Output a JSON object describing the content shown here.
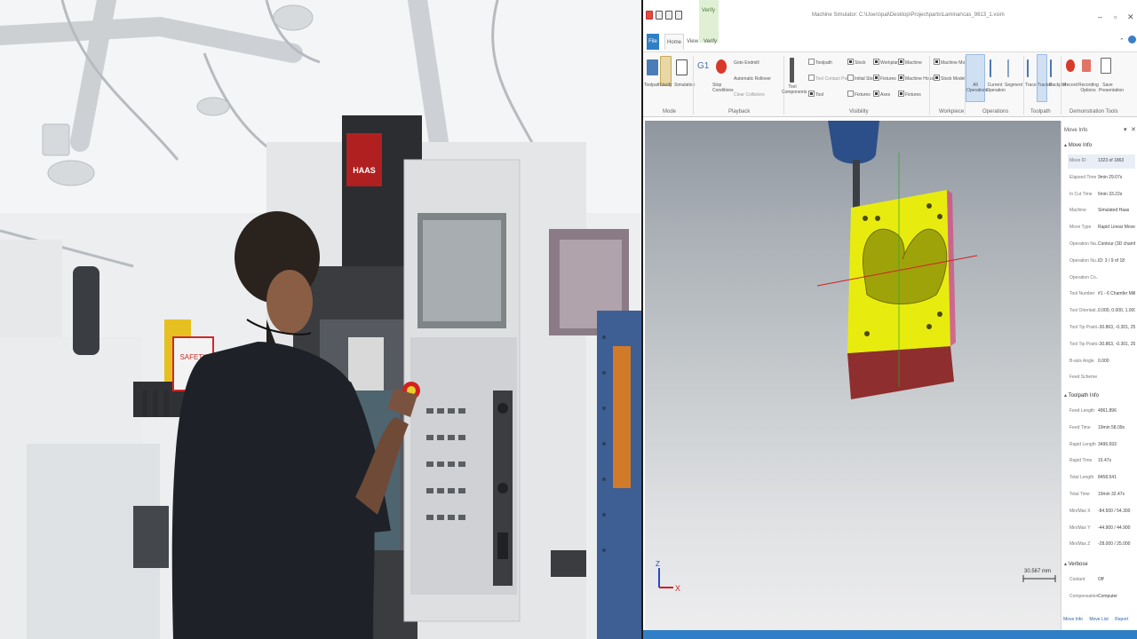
{
  "app": {
    "title": "Machine Simulator: C:\\Users\\pal\\Desktop\\Project\\parts\\Laminar\\cas_9813_1.vsim",
    "context_tab": "Verify",
    "tabs": [
      "File",
      "Home",
      "View",
      "Verify"
    ],
    "active_tab": "Home"
  },
  "ribbon": {
    "mode_buttons": [
      "Toolpath",
      "Verify",
      "Simulation"
    ],
    "playback_buttons": [
      "G1",
      "Stop Conditions"
    ],
    "playback_options": [
      "Goto Endmill",
      "Automatic Rollover",
      "Clear Collisions"
    ],
    "tool_component": "Tool Components",
    "visibility_col1": [
      "Toolpath",
      "Tool Contact Point",
      "Tool"
    ],
    "visibility_col2": [
      "Stock",
      "Initial Stock",
      "Fixtures"
    ],
    "visibility_col3": [
      "Workplane",
      "Fixtures",
      "Axes"
    ],
    "visibility_col4": [
      "Machine",
      "Machine Housing",
      "Fixtures"
    ],
    "workpiece_options": [
      "Machine Model",
      "Stock Model"
    ],
    "operation_buttons": [
      "All Operations",
      "Current Operation",
      "Segment"
    ],
    "toolpath_buttons": [
      "Trace",
      "Tracker",
      "Backplot"
    ],
    "demo_buttons": [
      "Record",
      "Recording Options",
      "Save Presentation"
    ],
    "groups": [
      "Mode",
      "Playback",
      "Visibility",
      "Workpiece",
      "Operations",
      "Toolpath",
      "Demonstration Tools"
    ]
  },
  "viewport": {
    "scale_label": "30.567 mm",
    "triad": {
      "z": "Z",
      "x": "X"
    },
    "colors": {
      "stock": "#e8ec0e",
      "base": "#8f2e2e",
      "tool": "#3a3f44",
      "spindle": "#2c4f8a"
    }
  },
  "panel": {
    "title": "Move Info",
    "sections": [
      {
        "name": "Move Info",
        "rows": [
          {
            "k": "Move ID",
            "v": "1323 of 1863"
          },
          {
            "k": "Elapsed Time",
            "v": "9min 29.07s"
          },
          {
            "k": "In Cut Time",
            "v": "6min 33.22s"
          },
          {
            "k": "Machine",
            "v": "Simulated Haas"
          },
          {
            "k": "Move Type",
            "v": "Rapid Linear Move"
          },
          {
            "k": "Operation Na...",
            "v": "Contour (3D chamf)"
          },
          {
            "k": "Operation Nu...",
            "v": "ID: 3 / 9 of 18"
          },
          {
            "k": "Operation Co...",
            "v": ""
          },
          {
            "k": "Tool Number",
            "v": "#1 - 6 Chamfer Mill"
          },
          {
            "k": "Tool Orientati...",
            "v": "0.000, 0.000, 1.000"
          },
          {
            "k": "Tool Tip Positi...",
            "v": "-30.863, -0.301, 25"
          },
          {
            "k": "Tool Tip Positi...",
            "v": "-30.863, -0.301, 25"
          },
          {
            "k": "B-axis Angle",
            "v": "0.000"
          },
          {
            "k": "Feed Scheme",
            "v": ""
          }
        ]
      },
      {
        "name": "Toolpath Info",
        "rows": [
          {
            "k": "Feed Length",
            "v": "4961.896"
          },
          {
            "k": "Feed Time",
            "v": "19min 58.09s"
          },
          {
            "k": "Rapid Length",
            "v": "3496.693"
          },
          {
            "k": "Rapid Time",
            "v": "15.47s"
          },
          {
            "k": "Total Length",
            "v": "8458.541"
          },
          {
            "k": "Total Time",
            "v": "19min 32.47s"
          },
          {
            "k": "Min/Max X",
            "v": "-84.500 / 54.300"
          },
          {
            "k": "Min/Max Y",
            "v": "-44.900 / 44.900"
          },
          {
            "k": "Min/Max Z",
            "v": "-28.000 / 25.000"
          }
        ]
      },
      {
        "name": "Verbose",
        "rows": [
          {
            "k": "Coolant",
            "v": "Off"
          },
          {
            "k": "Compensation...",
            "v": "Computer"
          }
        ]
      }
    ],
    "bottom_tabs": [
      "Move Info",
      "Move List",
      "Report"
    ]
  },
  "camera": {
    "brand_text": "HAAS",
    "sign_text": "SAFETY"
  }
}
